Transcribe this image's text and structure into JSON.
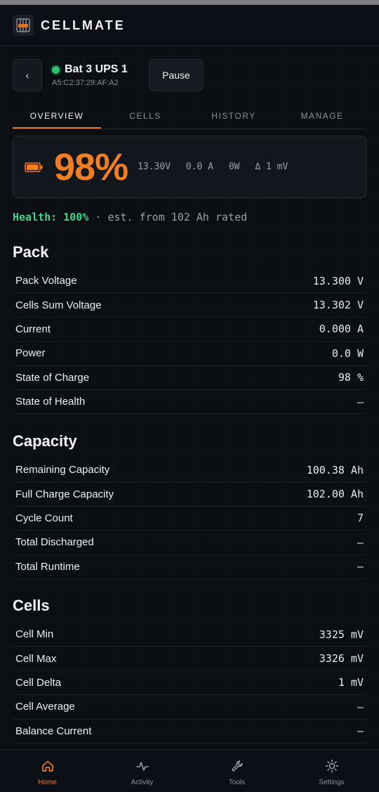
{
  "app": {
    "title": "CELLMATE"
  },
  "device": {
    "name": "Bat 3 UPS 1",
    "mac": "A5:C2:37:29:AF:A2",
    "pause_label": "Pause",
    "back_label": "‹"
  },
  "tabs": [
    {
      "label": "OVERVIEW"
    },
    {
      "label": "CELLS"
    },
    {
      "label": "HISTORY"
    },
    {
      "label": "MANAGE"
    }
  ],
  "summary": {
    "soc": "98%",
    "voltage": "13.30V",
    "current": "0.0 A",
    "power": "0W",
    "delta": "Δ 1 mV",
    "battery_fill": 0.98
  },
  "health": {
    "label": "Health:",
    "value": "100%",
    "note": "· est. from 102 Ah rated"
  },
  "pack": {
    "title": "Pack",
    "rows": [
      {
        "k": "Pack Voltage",
        "v": "13.300 V"
      },
      {
        "k": "Cells Sum Voltage",
        "v": "13.302 V"
      },
      {
        "k": "Current",
        "v": "0.000 A"
      },
      {
        "k": "Power",
        "v": "0.0 W"
      },
      {
        "k": "State of Charge",
        "v": "98 %"
      },
      {
        "k": "State of Health",
        "v": "–"
      }
    ]
  },
  "capacity": {
    "title": "Capacity",
    "rows": [
      {
        "k": "Remaining Capacity",
        "v": "100.38 Ah"
      },
      {
        "k": "Full Charge Capacity",
        "v": "102.00 Ah"
      },
      {
        "k": "Cycle Count",
        "v": "7"
      },
      {
        "k": "Total Discharged",
        "v": "–"
      },
      {
        "k": "Total Runtime",
        "v": "–"
      }
    ]
  },
  "cells": {
    "title": "Cells",
    "rows": [
      {
        "k": "Cell Min",
        "v": "3325 mV"
      },
      {
        "k": "Cell Max",
        "v": "3326 mV"
      },
      {
        "k": "Cell Delta",
        "v": "1 mV"
      },
      {
        "k": "Cell Average",
        "v": "–"
      },
      {
        "k": "Balance Current",
        "v": "–"
      }
    ]
  },
  "nav": [
    {
      "label": "Home",
      "icon": "home-icon"
    },
    {
      "label": "Activity",
      "icon": "activity-icon"
    },
    {
      "label": "Tools",
      "icon": "wrench-icon"
    },
    {
      "label": "Settings",
      "icon": "sun-gear-icon"
    }
  ],
  "colors": {
    "accent": "#f37d22",
    "status_ok": "#2fbf71",
    "health": "#3ed68a"
  }
}
